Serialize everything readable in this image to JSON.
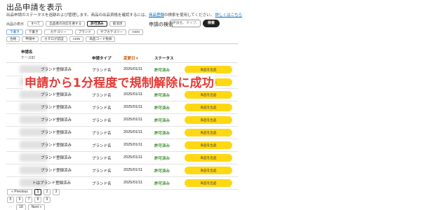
{
  "header": {
    "title": "出品申請を表示",
    "description": "出品申請のステータスを追跡および管理します。商品の出品資格を確認するには、",
    "description_link": "商品登録",
    "description_tail": "の検索を使用してください。",
    "detail_link": "詳しくはこちら"
  },
  "filters": {
    "row1_label": "出品の表示",
    "row1": [
      "すべて",
      "出品者の対応を要する",
      "許可済み",
      "取消済"
    ],
    "row1_selected": "許可済み",
    "row2": [
      "下書き",
      "下書き",
      "カテゴリー",
      "ブランド",
      "サブカテゴリー",
      "ASIN"
    ],
    "row3": [
      "合格",
      "申請中",
      "カタログ認証",
      "ASIN",
      "商品コード免除"
    ]
  },
  "search": {
    "label": "申請の検索",
    "placeholder": "申請名、タイプ、",
    "button": "検索"
  },
  "table": {
    "headers": {
      "name": "申請名",
      "name_sub": "ケースID",
      "type": "申請タイプ",
      "date": "変更日",
      "status": "ステータス"
    },
    "rows": [
      {
        "name": "ブランド登録済み",
        "type": "ブランド名",
        "date": "2025/01/11",
        "status": "許可済み",
        "action": "商品を出品"
      },
      {
        "name": "ブランド登録済み",
        "type": "ブランド名",
        "date": "2025/01/11",
        "status": "許可済み",
        "action": "商品を出品"
      },
      {
        "name": "ブランド登録済み",
        "type": "ブランド名",
        "date": "2025/01/11",
        "status": "許可済み",
        "action": "商品を出品"
      },
      {
        "name": "ブランド登録済み",
        "type": "ブランド名",
        "date": "2025/01/11",
        "status": "許可済み",
        "action": "商品を出品"
      },
      {
        "name": "ブランド登録済み",
        "type": "ブランド名",
        "date": "2025/01/11",
        "status": "許可済み",
        "action": "商品を出品"
      },
      {
        "name": "ブランド登録済み",
        "type": "ブランド名",
        "date": "2025/01/11",
        "status": "許可済み",
        "action": "商品を出品"
      },
      {
        "name": "ブランド登録済み",
        "type": "ブランド名",
        "date": "2025/01/11",
        "status": "許可済み",
        "action": "商品を出品"
      },
      {
        "name": "ブランド登録済み",
        "type": "ブランド名",
        "date": "2025/01/11",
        "status": "許可済み",
        "action": "商品を出品"
      },
      {
        "name": "ブランド登録済み",
        "type": "ブランド名",
        "date": "2025/01/11",
        "status": "許可済み",
        "action": "商品を出品"
      },
      {
        "name": "トはブランド登録済み",
        "type": "ブランド名",
        "date": "2025/01/11",
        "status": "許可済み",
        "action": "商品を出品"
      }
    ]
  },
  "overlay_text": "申請から1分程度で規制解除に成功",
  "pagination": {
    "previous": "« Previous",
    "next": "Next »",
    "current": "1",
    "row1": [
      "1",
      "2",
      "3"
    ],
    "row2": [
      "5",
      "6",
      "7",
      "8",
      "9"
    ],
    "row3_prefix": "...",
    "row3": [
      "18"
    ]
  },
  "colors": {
    "accent_button": "#ffd814",
    "status_green": "#3a8a2a",
    "overlay_red": "#e53935",
    "link_blue": "#0066c0"
  }
}
